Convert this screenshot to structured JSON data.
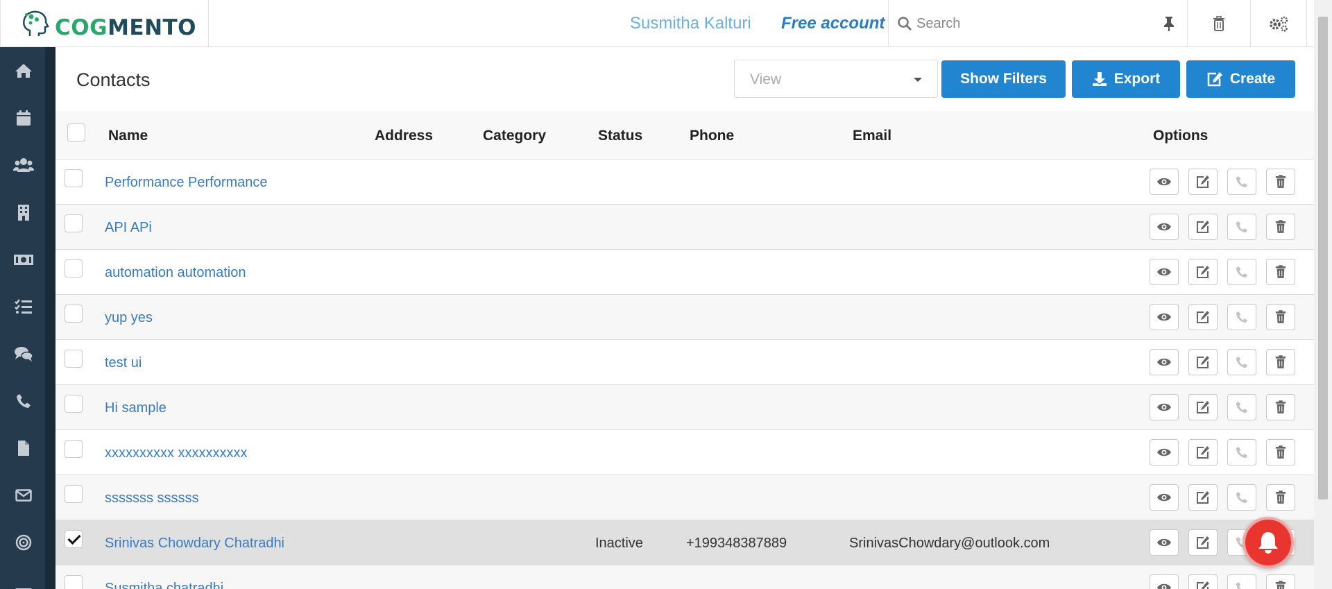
{
  "app": {
    "logo_text_1": "COG",
    "logo_text_2": "MENTO"
  },
  "header": {
    "user_name": "Susmitha Kalturi",
    "account_type": "Free account",
    "search_placeholder": "Search"
  },
  "sidebar": {
    "items": [
      "home-icon",
      "calendar-icon",
      "users-icon",
      "building-icon",
      "money-icon",
      "tasks-icon",
      "comments-icon",
      "phone-icon",
      "document-icon",
      "envelope-icon",
      "target-icon"
    ]
  },
  "page": {
    "title": "Contacts",
    "view_placeholder": "View",
    "buttons": {
      "show_filters": "Show Filters",
      "export": "Export",
      "create": "Create"
    }
  },
  "table": {
    "columns": {
      "name": "Name",
      "address": "Address",
      "category": "Category",
      "status": "Status",
      "phone": "Phone",
      "email": "Email",
      "options": "Options"
    },
    "rows": [
      {
        "name": "Performance Performance",
        "status": "",
        "phone": "",
        "email": "",
        "checked": false
      },
      {
        "name": "API APi",
        "status": "",
        "phone": "",
        "email": "",
        "checked": false
      },
      {
        "name": "automation automation",
        "status": "",
        "phone": "",
        "email": "",
        "checked": false
      },
      {
        "name": "yup yes",
        "status": "",
        "phone": "",
        "email": "",
        "checked": false
      },
      {
        "name": "test ui",
        "status": "",
        "phone": "",
        "email": "",
        "checked": false
      },
      {
        "name": "Hi sample",
        "status": "",
        "phone": "",
        "email": "",
        "checked": false
      },
      {
        "name": "xxxxxxxxxx xxxxxxxxxx",
        "status": "",
        "phone": "",
        "email": "",
        "checked": false
      },
      {
        "name": "sssssss ssssss",
        "status": "",
        "phone": "",
        "email": "",
        "checked": false
      },
      {
        "name": "Srinivas Chowdary Chatradhi",
        "status": "Inactive",
        "phone": "+199348387889",
        "email": "SrinivasChowdary@outlook.com",
        "checked": true
      },
      {
        "name": "Susmitha chatradhi",
        "status": "",
        "phone": "",
        "email": "",
        "checked": false
      }
    ]
  },
  "colors": {
    "primary": "#2185d0",
    "sidebar": "#263a4d",
    "link": "#3a7bbf",
    "bell": "#e8352f"
  }
}
